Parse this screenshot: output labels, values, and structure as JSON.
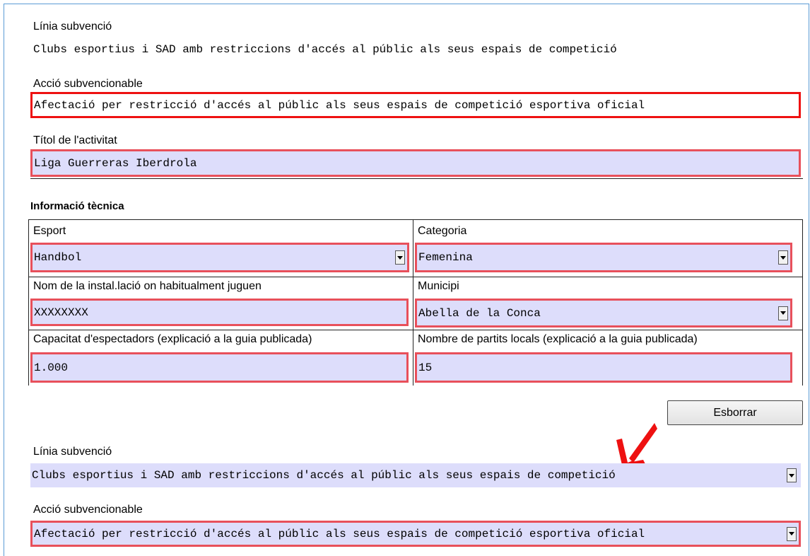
{
  "block1": {
    "linia_label": "Línia subvenció",
    "linia_value": "Clubs esportius i SAD amb restriccions d'accés al públic als seus espais de competició",
    "accio_label": "Acció subvencionable",
    "accio_value": "Afectació per restricció d'accés al públic als seus espais de competició esportiva oficial",
    "titol_label": "Títol de l'activitat",
    "titol_value": "Liga Guerreras Iberdrola"
  },
  "tecnica": {
    "heading": "Informació tècnica",
    "esport_label": "Esport",
    "esport_value": "Handbol",
    "categoria_label": "Categoria",
    "categoria_value": "Femenina",
    "installacio_label": "Nom de la instal.lació on habitualment juguen",
    "installacio_value": "XXXXXXXX",
    "municipi_label": "Municipi",
    "municipi_value": "Abella de la Conca",
    "capacitat_label": "Capacitat d'espectadors (explicació a la guia publicada)",
    "capacitat_value": "1.000",
    "partits_label": "Nombre de partits locals (explicació a la guia publicada)",
    "partits_value": "15"
  },
  "actions": {
    "esborrar_label": "Esborrar"
  },
  "block2": {
    "linia_label": "Línia subvenció",
    "linia_value": "Clubs esportius i SAD amb restriccions d'accés al públic als seus espais de competició",
    "accio_label": "Acció subvencionable",
    "accio_value": "Afectació per restricció d'accés al públic als seus espais de competició esportiva oficial"
  },
  "colors": {
    "field_bg": "#ddddfb",
    "field_border": "#e8505b",
    "highlight_border": "#ee1111",
    "annotation_arrow": "#ee1111",
    "frame_border": "#5b9bd5"
  },
  "icons": {
    "dropdown": "chevron-down-icon",
    "annotation": "arrow-annotation-icon"
  }
}
